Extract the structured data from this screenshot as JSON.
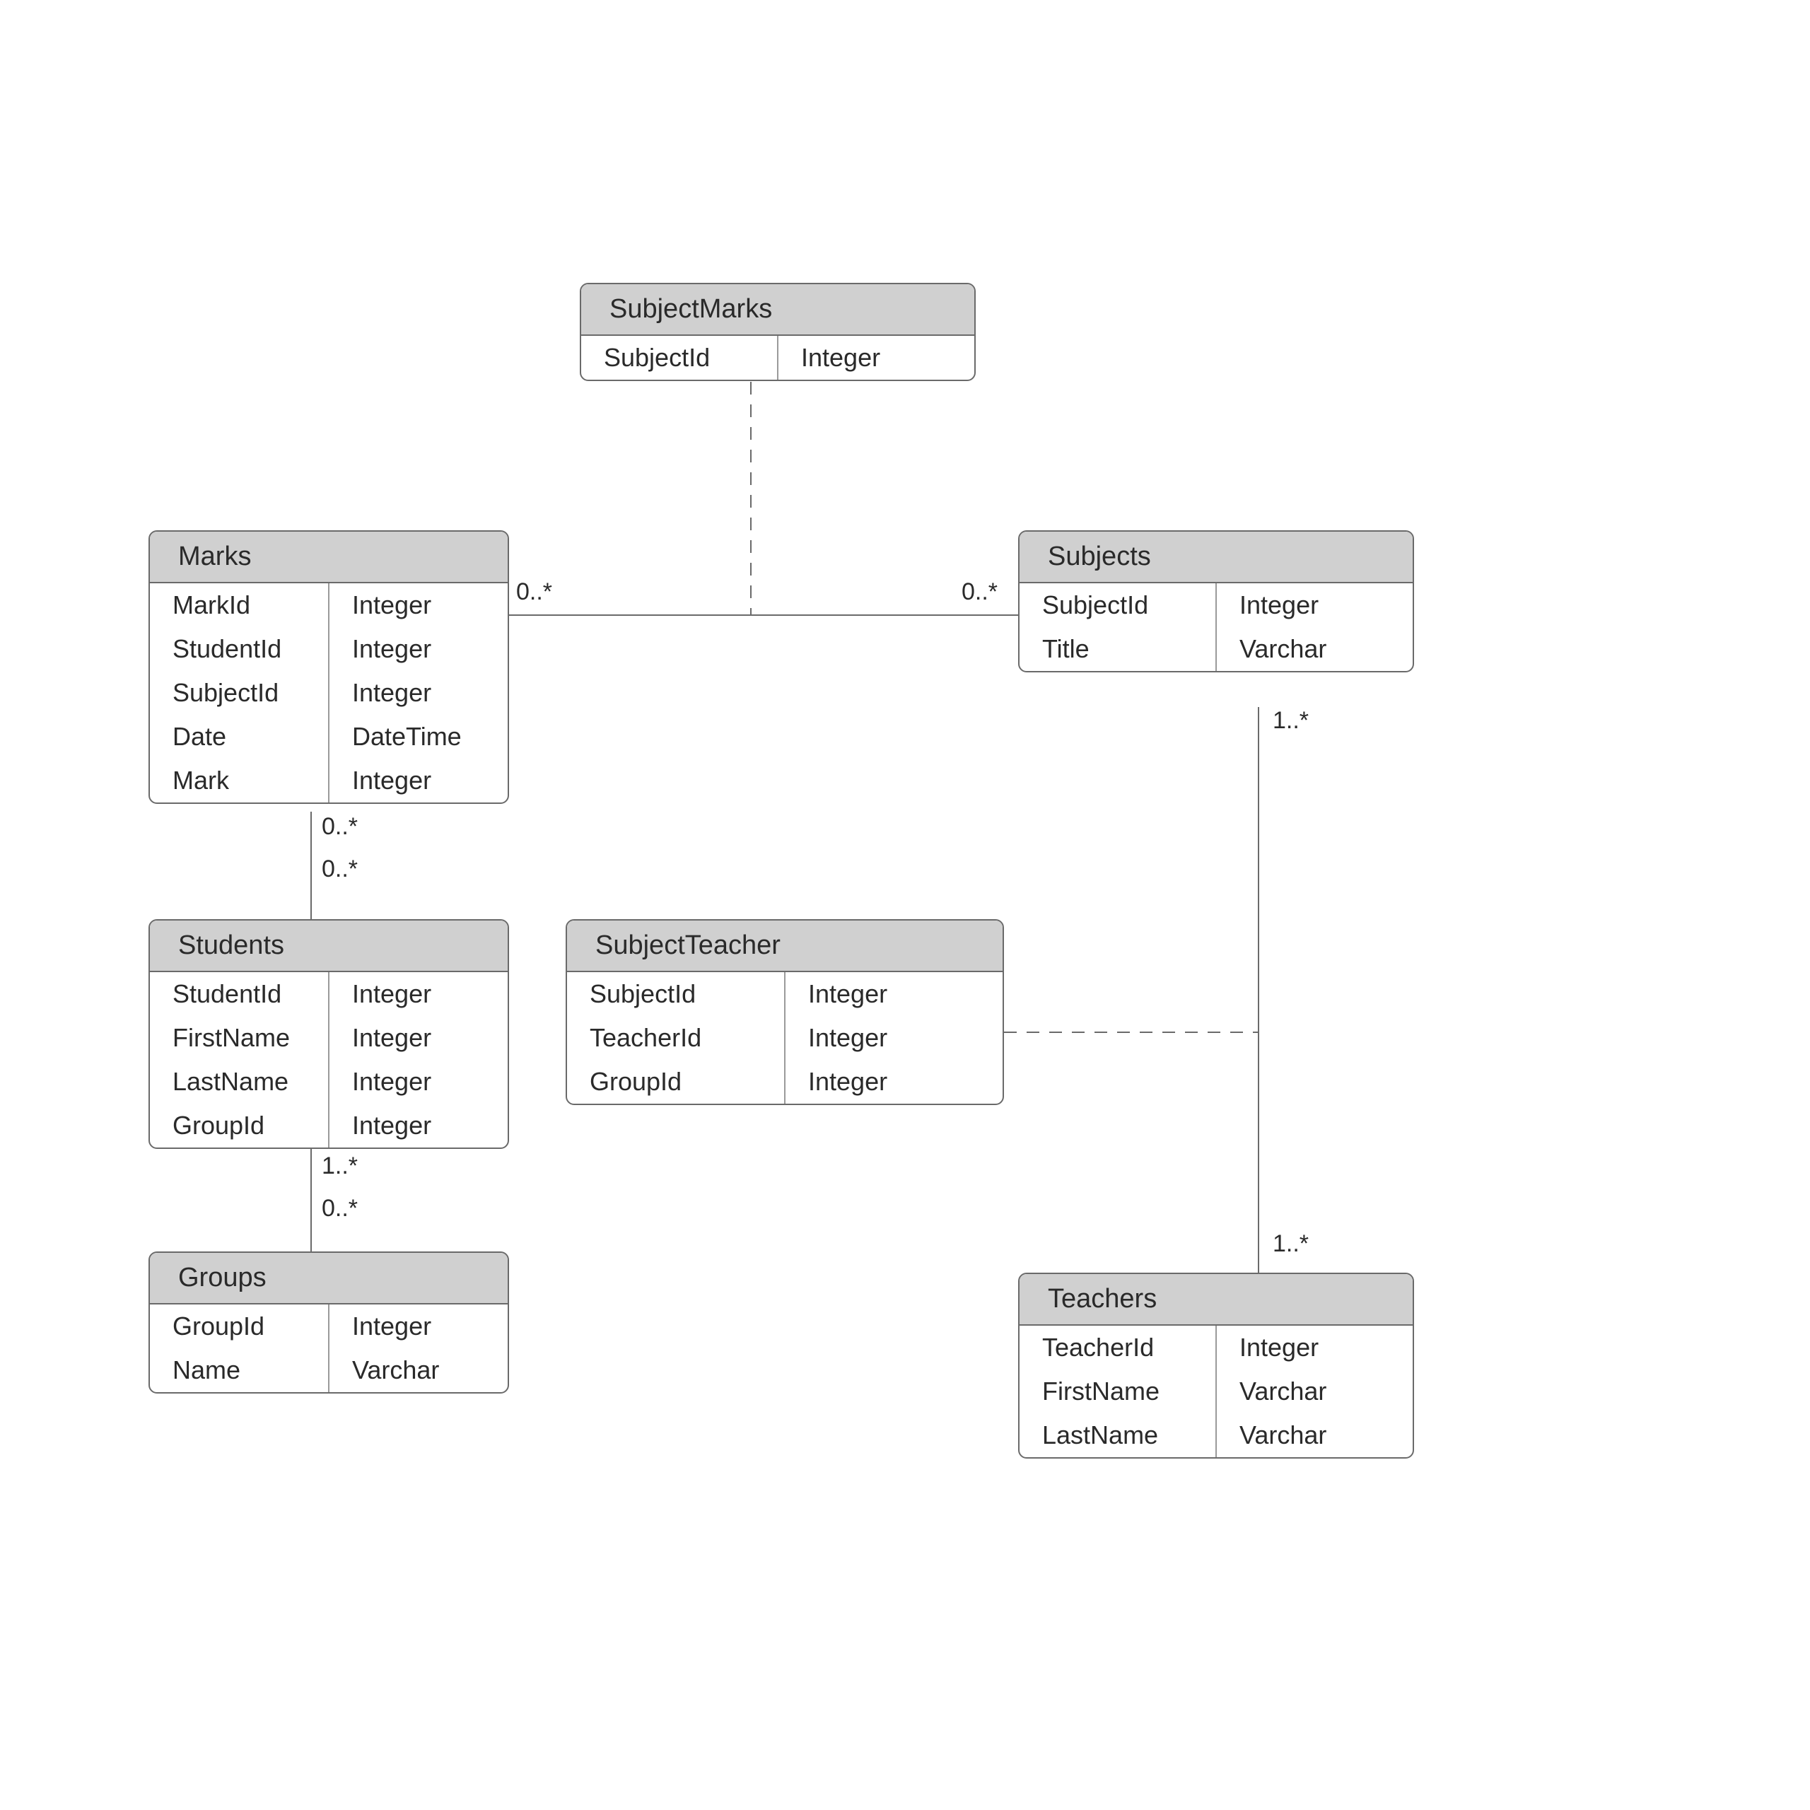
{
  "entities": {
    "subjectMarks": {
      "title": "SubjectMarks",
      "rows": [
        {
          "name": "SubjectId",
          "type": "Integer"
        }
      ]
    },
    "marks": {
      "title": "Marks",
      "rows": [
        {
          "name": "MarkId",
          "type": "Integer"
        },
        {
          "name": "StudentId",
          "type": "Integer"
        },
        {
          "name": "SubjectId",
          "type": "Integer"
        },
        {
          "name": "Date",
          "type": "DateTime"
        },
        {
          "name": "Mark",
          "type": "Integer"
        }
      ]
    },
    "subjects": {
      "title": "Subjects",
      "rows": [
        {
          "name": "SubjectId",
          "type": "Integer"
        },
        {
          "name": "Title",
          "type": "Varchar"
        }
      ]
    },
    "students": {
      "title": "Students",
      "rows": [
        {
          "name": "StudentId",
          "type": "Integer"
        },
        {
          "name": "FirstName",
          "type": "Integer"
        },
        {
          "name": "LastName",
          "type": "Integer"
        },
        {
          "name": "GroupId",
          "type": "Integer"
        }
      ]
    },
    "subjectTeacher": {
      "title": "SubjectTeacher",
      "rows": [
        {
          "name": "SubjectId",
          "type": "Integer"
        },
        {
          "name": "TeacherId",
          "type": "Integer"
        },
        {
          "name": "GroupId",
          "type": "Integer"
        }
      ]
    },
    "groups": {
      "title": "Groups",
      "rows": [
        {
          "name": "GroupId",
          "type": "Integer"
        },
        {
          "name": "Name",
          "type": "Varchar"
        }
      ]
    },
    "teachers": {
      "title": "Teachers",
      "rows": [
        {
          "name": "TeacherId",
          "type": "Integer"
        },
        {
          "name": "FirstName",
          "type": "Varchar"
        },
        {
          "name": "LastName",
          "type": "Varchar"
        }
      ]
    }
  },
  "multiplicities": {
    "marks_right": "0..*",
    "subjects_left": "0..*",
    "marks_bottom": "0..*",
    "students_top": "0..*",
    "students_bottom": "1..*",
    "groups_top": "0..*",
    "subjects_bottom": "1..*",
    "teachers_top": "1..*"
  }
}
